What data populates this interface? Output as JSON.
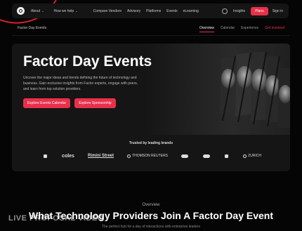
{
  "nav": {
    "about": "About",
    "how_we_help": "How we help",
    "compare_vendors": "Compare Vendors",
    "advisory": "Advisory",
    "platforms": "Platforms",
    "events": "Events",
    "elearning": "eLearning",
    "insights": "Insights",
    "plans": "Plans",
    "sign_in": "Sign in"
  },
  "breadcrumb": "Factor Day Events",
  "tabs": [
    "Overview",
    "Calendar",
    "Experience",
    "Get involved"
  ],
  "hero": {
    "title": "Factor Day Events",
    "description": "Uncover the major ideas and trends defining the future of technology and business. Gain exclusive insights from Factor experts, engage with peers, and learn from top solution providers.",
    "btn_explore": "Explore Events Calendar",
    "btn_sponsor": "Explore Sponsorship",
    "trusted": "Trusted by leading brands",
    "brands": [
      "",
      "coles",
      "Rimini Street",
      "THOMSON REUTERS",
      "",
      "",
      "",
      "ZURICH"
    ]
  },
  "overview": {
    "label": "Overview",
    "headline": "What Technology Providers Join A Factor Day Event",
    "subhead": "The perfect hub for a day of interactions with enterprise leaders"
  },
  "watermark": "LIVE PROPOSAL VIDEO",
  "colors": {
    "accent": "#e8304a",
    "background": "#050505",
    "panel": "#151515"
  }
}
